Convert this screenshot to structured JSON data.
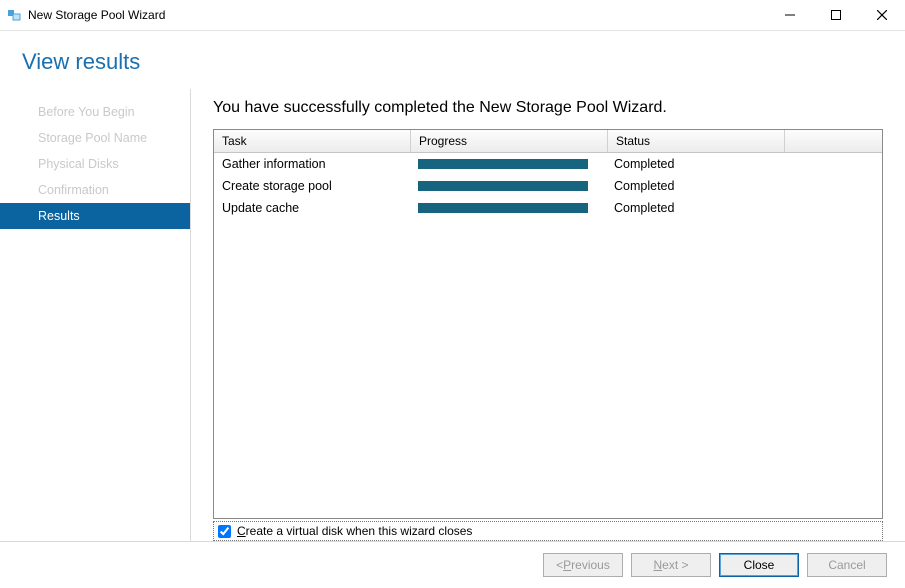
{
  "window": {
    "title": "New Storage Pool Wizard"
  },
  "header": {
    "title": "View results"
  },
  "nav": {
    "items": [
      {
        "label": "Before You Begin"
      },
      {
        "label": "Storage Pool Name"
      },
      {
        "label": "Physical Disks"
      },
      {
        "label": "Confirmation"
      },
      {
        "label": "Results"
      }
    ],
    "active_index": 4
  },
  "pane": {
    "heading": "You have successfully completed the New Storage Pool Wizard.",
    "columns": {
      "task": "Task",
      "progress": "Progress",
      "status": "Status"
    },
    "rows": [
      {
        "task": "Gather information",
        "status": "Completed"
      },
      {
        "task": "Create storage pool",
        "status": "Completed"
      },
      {
        "task": "Update cache",
        "status": "Completed"
      }
    ],
    "checkbox": {
      "checked": true,
      "prefix": "C",
      "rest": "reate a virtual disk when this wizard closes"
    }
  },
  "footer": {
    "prev_prefix": "< ",
    "prev_ul": "P",
    "prev_rest": "revious",
    "next_ul": "N",
    "next_rest": "ext >",
    "close": "Close",
    "cancel": "Cancel"
  },
  "colors": {
    "accent": "#0b64a0",
    "progress": "#17647e"
  }
}
